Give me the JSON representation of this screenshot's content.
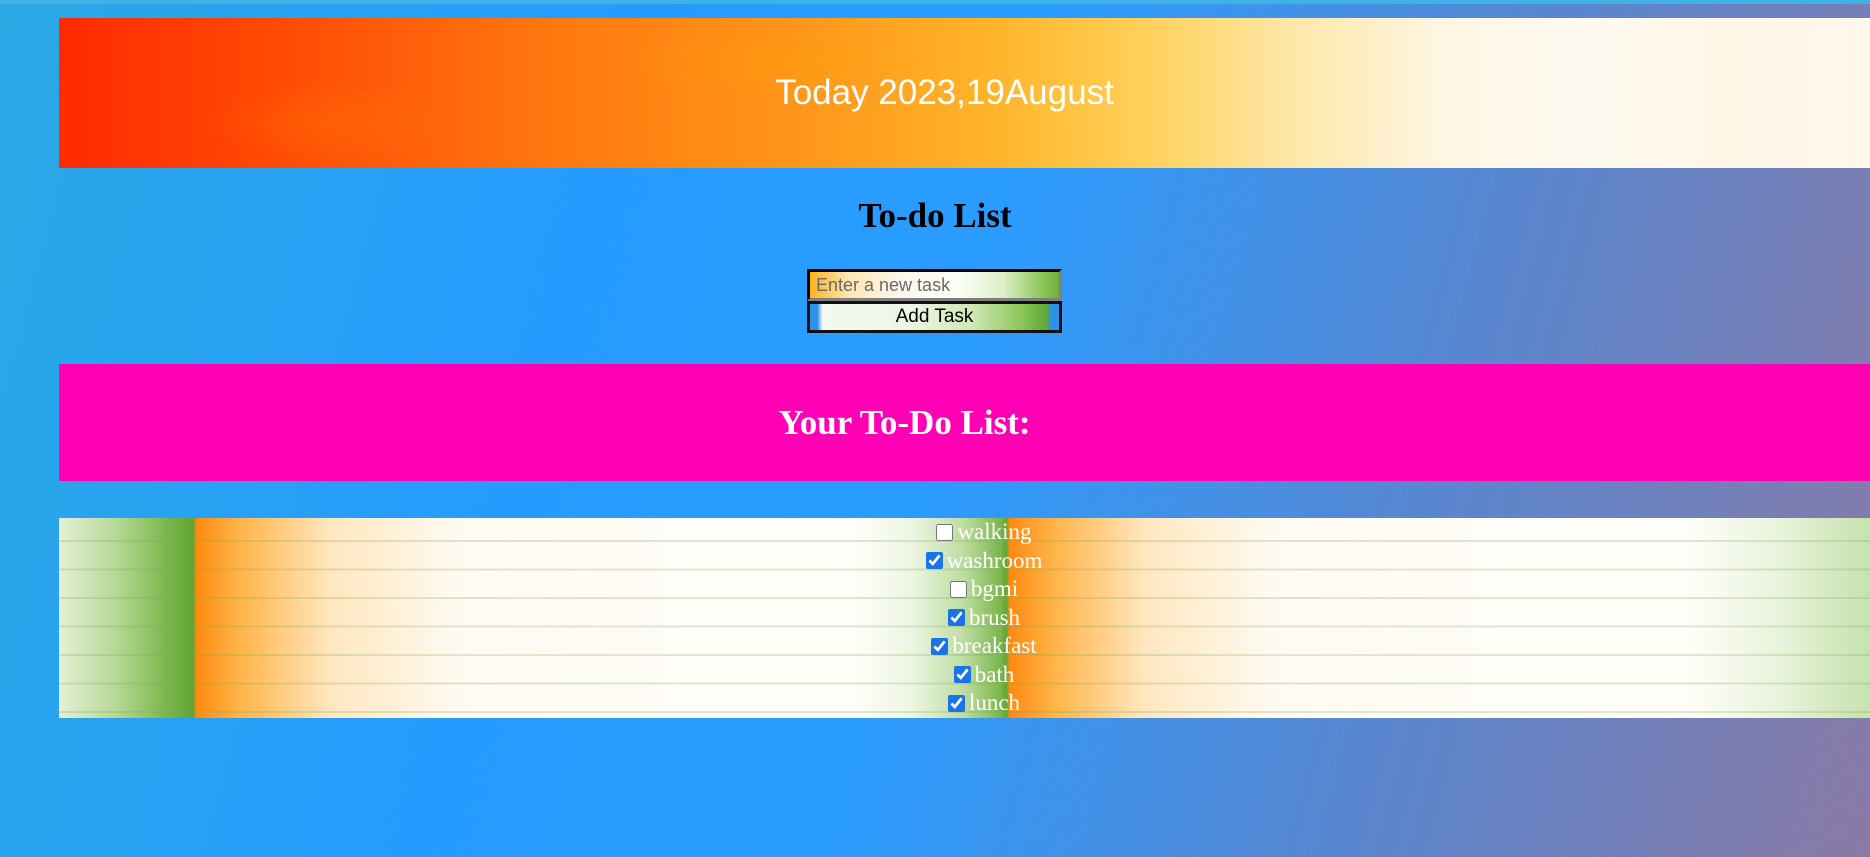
{
  "header": {
    "date_text": "Today 2023,19August"
  },
  "app": {
    "title": "To-do List"
  },
  "form": {
    "input_placeholder": "Enter a new task",
    "input_value": "",
    "add_button_label": "Add Task"
  },
  "list": {
    "heading": "Your To-Do List:",
    "tasks": [
      {
        "label": "walking",
        "checked": false
      },
      {
        "label": "washroom",
        "checked": true
      },
      {
        "label": "bgmi",
        "checked": false
      },
      {
        "label": "brush",
        "checked": true
      },
      {
        "label": "breakfast",
        "checked": true
      },
      {
        "label": "bath",
        "checked": true
      },
      {
        "label": "lunch",
        "checked": true
      }
    ]
  },
  "colors": {
    "background_start": "#2aa9e4",
    "background_end": "#8a7aa5",
    "list_banner": "#ff00b4",
    "date_banner_start": "#ff2a00",
    "date_banner_end": "#fdf7ec"
  }
}
